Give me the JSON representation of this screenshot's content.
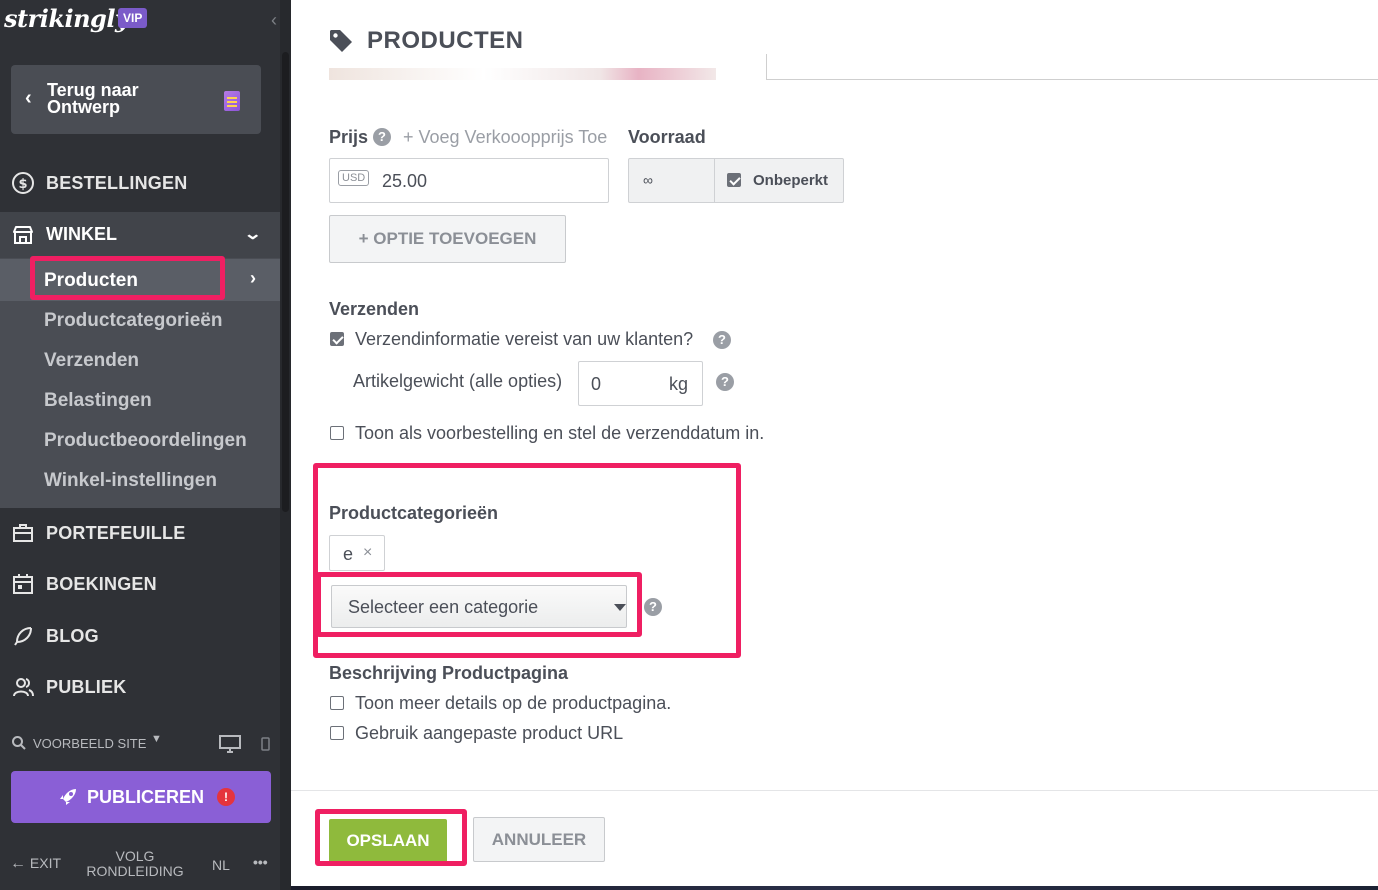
{
  "app": {
    "logo": "strikingly",
    "plan_badge": "VIP"
  },
  "sidebar": {
    "back_button": "Terug naar Ontwerp",
    "nav": {
      "orders": "BESTELLINGEN",
      "store": "WINKEL",
      "portfolio": "PORTEFEUILLE",
      "bookings": "BOEKINGEN",
      "blog": "BLOG",
      "audience": "PUBLIEK"
    },
    "store_items": [
      "Producten",
      "Productcategorieën",
      "Verzenden",
      "Belastingen",
      "Productbeoordelingen",
      "Winkel-instellingen"
    ],
    "preview_site": "VOORBEELD SITE",
    "publish": "PUBLICEREN",
    "publish_badge": "!",
    "exit": "EXIT",
    "tour": "VOLG RONDLEIDING",
    "language": "NL",
    "more": "•••"
  },
  "main": {
    "title": "PRODUCTEN",
    "price": {
      "label": "Prijs",
      "add_sale_price": "+ Voeg Verkooopprijs Toe",
      "currency": "USD",
      "value": "25.00"
    },
    "stock": {
      "label": "Voorraad",
      "value": "∞",
      "unlimited_label": "Onbeperkt",
      "unlimited_checked": true
    },
    "add_option": "+ OPTIE TOEVOEGEN",
    "shipping": {
      "label": "Verzenden",
      "require_info": "Verzendinformatie vereist van uw klanten?",
      "require_info_checked": true,
      "weight_label": "Artikelgewicht (alle opties)",
      "weight_value": "0",
      "weight_unit": "kg",
      "preorder": "Toon als voorbestelling en stel de verzenddatum in.",
      "preorder_checked": false
    },
    "categories": {
      "label": "Productcategorieën",
      "selected_chip": "e",
      "chip_remove": "×",
      "select_placeholder": "Selecteer een categorie"
    },
    "description": {
      "label": "Beschrijving Productpagina",
      "more_details": "Toon meer details op de productpagina.",
      "custom_url": "Gebruik aangepaste product URL"
    },
    "save": "OPSLAAN",
    "cancel": "ANNULEER"
  },
  "colors": {
    "sidebar_bg": "#2f3136",
    "publish_purple": "#8a5fd6",
    "save_green": "#8fba3c",
    "highlight": "#ef1f62"
  }
}
